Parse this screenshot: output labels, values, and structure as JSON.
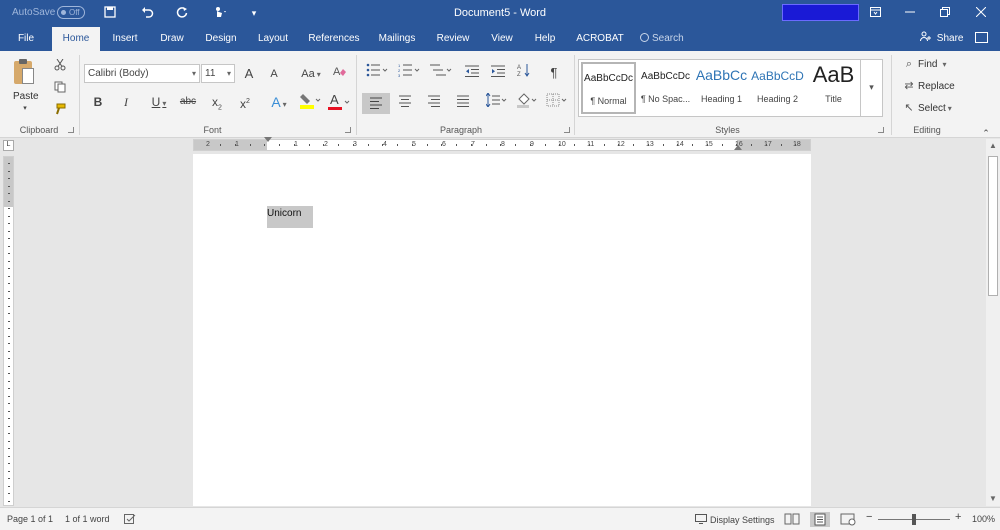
{
  "titlebar": {
    "autosave_label": "AutoSave",
    "autosave_state": "Off",
    "title": "Document5  -  Word"
  },
  "tabs": [
    {
      "label": "File",
      "active": false
    },
    {
      "label": "Home",
      "active": true
    },
    {
      "label": "Insert",
      "active": false
    },
    {
      "label": "Draw",
      "active": false
    },
    {
      "label": "Design",
      "active": false
    },
    {
      "label": "Layout",
      "active": false
    },
    {
      "label": "References",
      "active": false
    },
    {
      "label": "Mailings",
      "active": false
    },
    {
      "label": "Review",
      "active": false
    },
    {
      "label": "View",
      "active": false
    },
    {
      "label": "Help",
      "active": false
    },
    {
      "label": "ACROBAT",
      "active": false
    }
  ],
  "search_label": "Search",
  "share_label": "Share",
  "ribbon": {
    "clipboard": {
      "paste_label": "Paste",
      "group_label": "Clipboard"
    },
    "font": {
      "font_name": "Calibri (Body)",
      "font_size": "11",
      "grow_label": "A",
      "shrink_label": "A",
      "case_label": "Aa",
      "bold": "B",
      "italic": "I",
      "underline": "U",
      "strike": "abc",
      "sub": "x",
      "sub_mark": "2",
      "sup": "x",
      "sup_mark": "2",
      "effects": "A",
      "color": "A",
      "group_label": "Font"
    },
    "paragraph": {
      "pilcrow": "¶",
      "group_label": "Paragraph"
    },
    "styles": {
      "group_label": "Styles",
      "items": [
        {
          "sample": "AaBbCcDc",
          "name": "¶ Normal",
          "selected": true
        },
        {
          "sample": "AaBbCcDc",
          "name": "¶ No Spac...",
          "selected": false
        },
        {
          "sample": "AaBbCc",
          "name": "Heading 1",
          "selected": false
        },
        {
          "sample": "AaBbCcD",
          "name": "Heading 2",
          "selected": false
        },
        {
          "sample": "AaB",
          "name": "Title",
          "selected": false
        }
      ]
    },
    "editing": {
      "find_label": "Find",
      "replace_label": "Replace",
      "select_label": "Select",
      "group_label": "Editing"
    }
  },
  "ruler": {
    "labels": [
      "2",
      "1",
      "1",
      "2",
      "3",
      "4",
      "5",
      "6",
      "7",
      "8",
      "9",
      "10",
      "11",
      "12",
      "13",
      "14",
      "15",
      "16",
      "17",
      "18"
    ],
    "corner": "L"
  },
  "document": {
    "text": "Unicorn"
  },
  "statusbar": {
    "page": "Page 1 of 1",
    "words": "1 of 1 word",
    "display_settings": "Display Settings",
    "zoom_minus": "−",
    "zoom_plus": "+",
    "zoom": "100%"
  },
  "colors": {
    "accent": "#2b579a",
    "highlight": "#ffff00",
    "font_color": "#e81123"
  }
}
